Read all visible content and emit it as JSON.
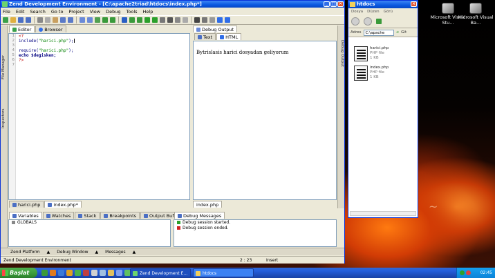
{
  "desktop": {
    "icons": [
      {
        "label": "Microsoft Visual Stu..."
      },
      {
        "label": "Microsoft Visual Ba..."
      }
    ]
  },
  "zend": {
    "title": "Zend Development Environment - [C:\\apache2triad\\htdocs\\index.php*]",
    "menu": [
      "File",
      "Edit",
      "Search",
      "Go to",
      "Project",
      "View",
      "Debug",
      "Tools",
      "Help"
    ],
    "left_tabs": [
      "File Manager",
      "Inspectors"
    ],
    "editor_tabs": [
      "Editor",
      "Browser"
    ],
    "line_numbers": [
      "1",
      "2",
      "3",
      "4",
      "5",
      "6",
      "7"
    ],
    "code": {
      "l1": "<?",
      "l2_fn": "include(",
      "l2_str": "\"harici.php\"",
      "l2_end": ");",
      "l4_fn": "require(",
      "l4_str": "\"harici.php\"",
      "l4_end": ");",
      "l5": "echo $degisken;",
      "l6": "?>"
    },
    "file_tabs": [
      "harici.php",
      "index.php*"
    ],
    "debug_output": {
      "title": "Debug Output",
      "tabs": [
        "Text",
        "HTML"
      ],
      "content": "Bytrislasis harici dosyadan geliyorum",
      "file_tab": "index.php",
      "right_strip": "Debug Output"
    },
    "bottom_left": {
      "tabs": [
        "Variables",
        "Watches",
        "Stack",
        "Breakpoints",
        "Output Buffer"
      ],
      "rows": [
        "GLOBALS"
      ]
    },
    "bottom_right": {
      "tab": "Debug Messages",
      "rows": [
        "Debug session started.",
        "Debug session ended."
      ]
    },
    "task_strip": [
      "Zend Platform",
      "Debug Window",
      "Messages"
    ],
    "status": {
      "left": "Zend Development Environment",
      "pos": "2 : 23",
      "mode": "Insert"
    }
  },
  "explorer": {
    "title": "htdocs",
    "menu": [
      "Dosya",
      "Düzen",
      "Görü"
    ],
    "address_label": "Adres",
    "address_value": "C:\\apache",
    "go_label": "Git",
    "files": [
      {
        "name": "harici.php",
        "type": "PHP file",
        "size": "1 KB"
      },
      {
        "name": "index.php",
        "type": "PHP file",
        "size": "1 KB"
      }
    ]
  },
  "taskbar": {
    "start": "Başlat",
    "buttons": [
      "Zend Development E...",
      "htdocs"
    ],
    "clock": "02:45"
  },
  "colors": {
    "xp_blue": "#0a58e0",
    "start_green": "#3a9a3a",
    "window_bg": "#ece9d8"
  }
}
